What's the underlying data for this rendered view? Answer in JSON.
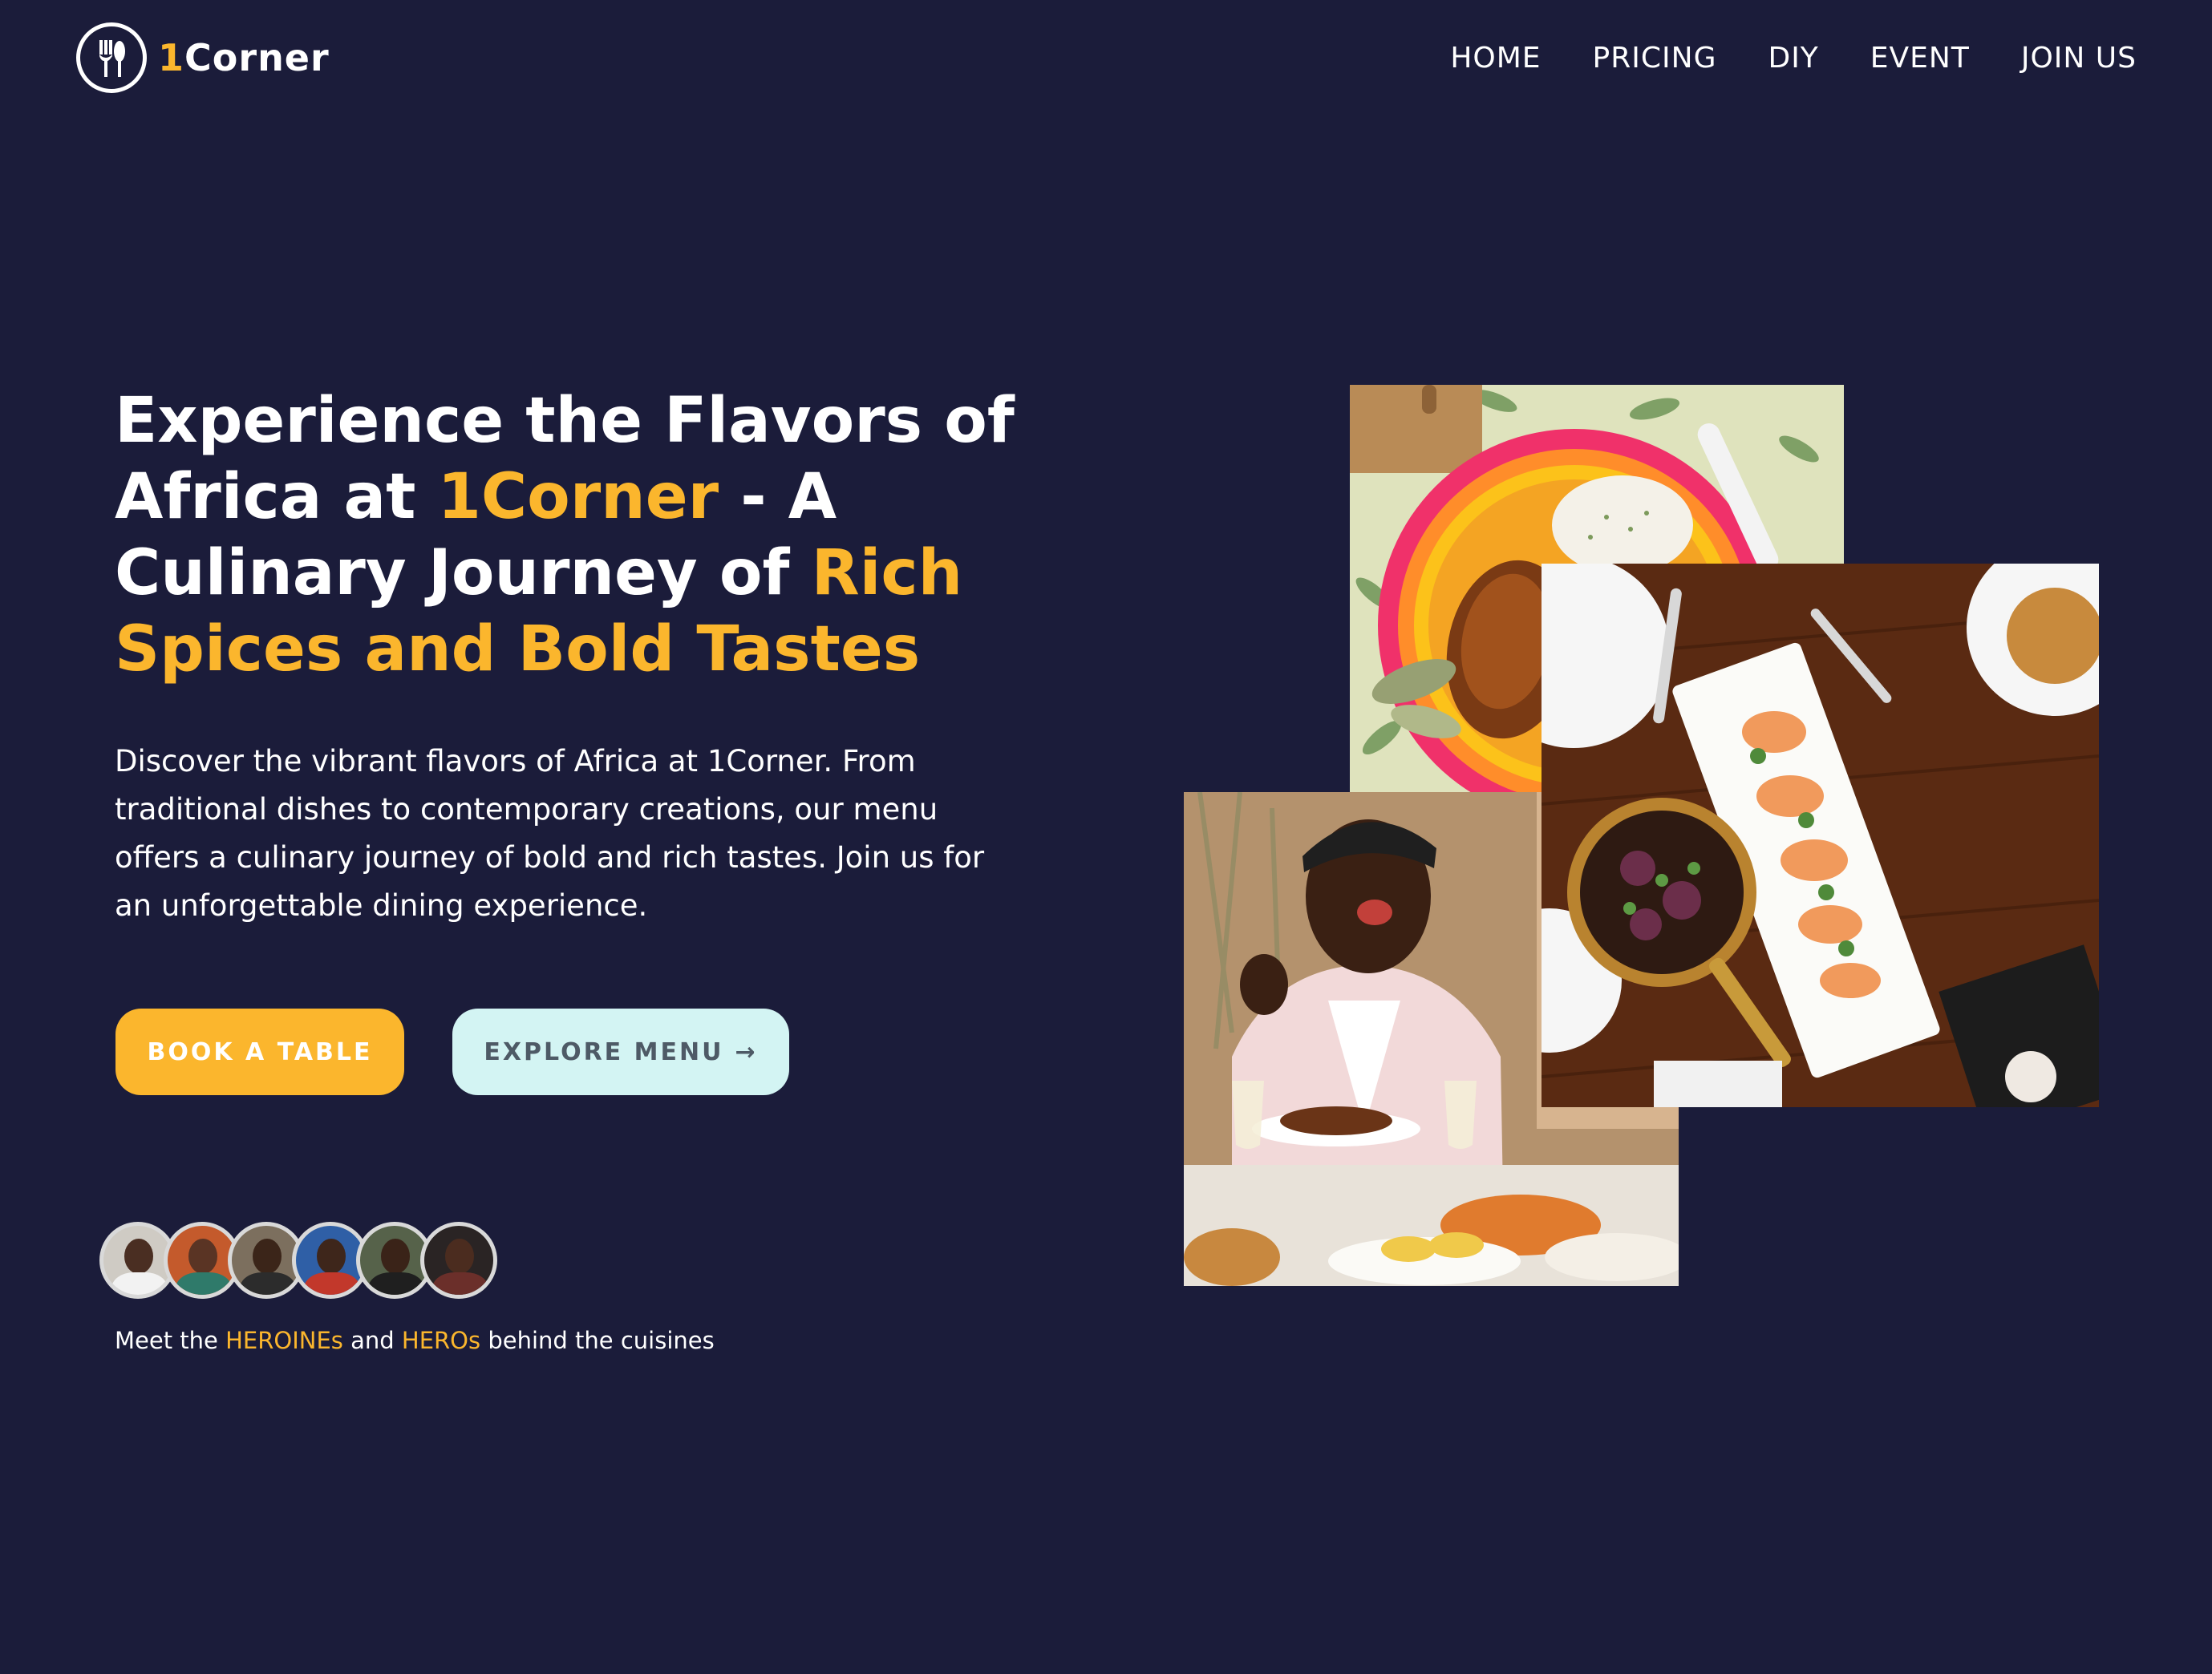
{
  "header": {
    "logo": {
      "brand_accent": "1",
      "brand_rest": "Corner",
      "icon": "fork-spoon-icon"
    },
    "nav": [
      {
        "label": "HOME"
      },
      {
        "label": "PRICING"
      },
      {
        "label": "DIY"
      },
      {
        "label": "EVENT"
      },
      {
        "label": "JOIN US"
      }
    ]
  },
  "hero": {
    "title": {
      "part1": "Experience the Flavors of Africa at ",
      "accent1": "1Corner",
      "part2": " - A Culinary Journey of ",
      "accent2": "Rich Spices and Bold Tastes"
    },
    "description": "Discover the vibrant flavors of Africa at 1Corner. From traditional dishes to contemporary creations, our menu offers a culinary journey of bold and rich tastes. Join us for an unforgettable dining experience.",
    "buttons": {
      "book": "BOOK A TABLE",
      "menu": "EXPLORE MENU",
      "menu_arrow": "→"
    },
    "meet": {
      "prefix": "Meet the ",
      "heroines": "HEROINEs",
      "middle": " and ",
      "heroes": "HEROs",
      "suffix": " behind the cuisines"
    },
    "avatar_count": 6
  },
  "colors": {
    "background": "#1b1c3a",
    "accent": "#fbb62d",
    "secondary_button": "#d3f4f3",
    "text": "#ffffff"
  }
}
